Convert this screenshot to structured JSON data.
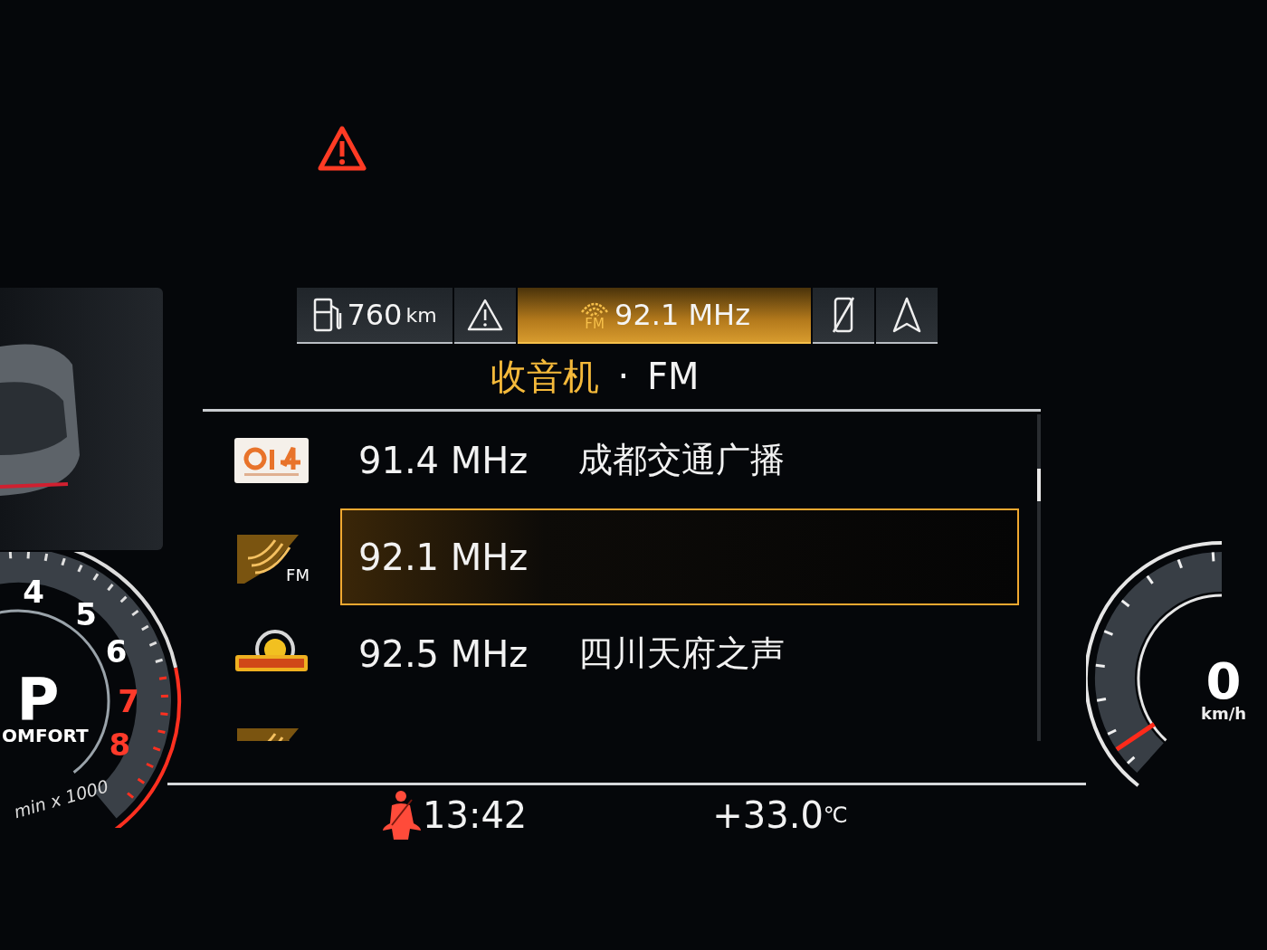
{
  "tabs": [
    {
      "kind": "fuel",
      "label": "760",
      "unit": "km",
      "selected": false
    },
    {
      "kind": "warning",
      "selected": false
    },
    {
      "kind": "radio",
      "badge": "FM",
      "label": "92.1 MHz",
      "selected": true
    },
    {
      "kind": "phone",
      "selected": false
    },
    {
      "kind": "navigation",
      "selected": false
    }
  ],
  "heading": {
    "source": "收音机",
    "separator": "·",
    "band": "FM"
  },
  "stations": [
    {
      "kind": "white-badge",
      "frequency": "91.4 MHz",
      "name": "成都交通广播",
      "selected": false
    },
    {
      "kind": "generic",
      "logo_label": "FM",
      "frequency": "92.1 MHz",
      "selected": true
    },
    {
      "kind": "emblem",
      "frequency": "92.5 MHz",
      "name": "四川天府之声",
      "selected": false
    },
    {
      "kind": "generic"
    }
  ],
  "tachometer": {
    "numbers": [
      {
        "label": "4",
        "redline": false
      },
      {
        "label": "5",
        "redline": false
      },
      {
        "label": "6",
        "redline": false
      },
      {
        "label": "7",
        "redline": true
      },
      {
        "label": "8",
        "redline": true
      }
    ],
    "gear": "P",
    "mode": "OMFORT",
    "unit": "min x 1000"
  },
  "speedometer": {
    "speed": "0",
    "unit": "km/h"
  },
  "status_bar": {
    "time": "13:42",
    "temperature": "+33.0",
    "temperature_unit": "℃"
  }
}
